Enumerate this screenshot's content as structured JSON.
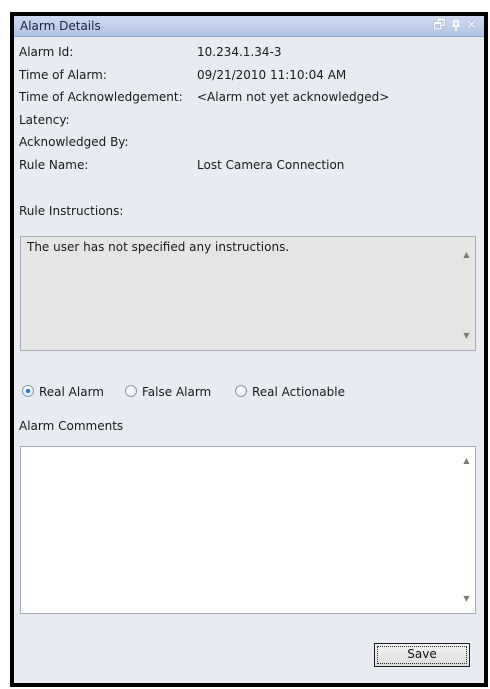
{
  "window": {
    "title": "Alarm Details",
    "buttons": {
      "restore_icon": "🗗",
      "pin_icon": "ᵖ",
      "close_icon": "✕"
    }
  },
  "details": [
    {
      "label": "Alarm Id:",
      "value": "10.234.1.34-3"
    },
    {
      "label": "Time of Alarm:",
      "value": "09/21/2010 11:10:04 AM"
    },
    {
      "label": "Time of Acknowledgement:",
      "value": "<Alarm not yet acknowledged>"
    },
    {
      "label": "Latency:",
      "value": ""
    },
    {
      "label": "Acknowledged By:",
      "value": ""
    },
    {
      "label": "Rule Name:",
      "value": "Lost Camera Connection"
    }
  ],
  "rule_instructions": {
    "label": "Rule Instructions:",
    "text": "The user has not specified any instructions."
  },
  "alarm_type": {
    "selected": "Real Alarm",
    "options": [
      "Real Alarm",
      "False Alarm",
      "Real Actionable"
    ]
  },
  "alarm_comments": {
    "label": "Alarm Comments",
    "value": ""
  },
  "actions": {
    "save_label": "Save"
  },
  "colors": {
    "titlebar": "#c2d1ee",
    "panel": "#e8ebf1",
    "frame": "#000000"
  }
}
